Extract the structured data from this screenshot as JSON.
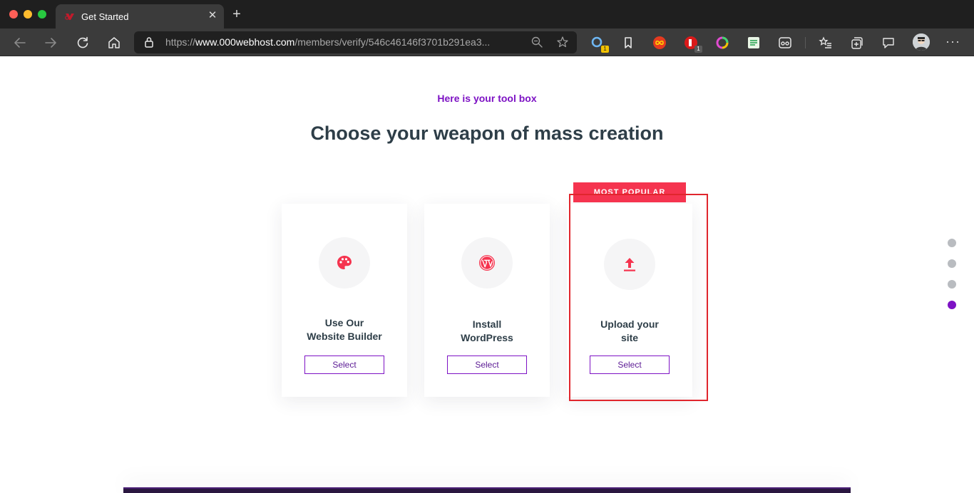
{
  "browser": {
    "tab_title": "Get Started",
    "url_scheme": "https://",
    "url_host": "www.000webhost.com",
    "url_path": "/members/verify/546c46146f3701b291ea3...",
    "extension_badges": [
      "1",
      "1"
    ]
  },
  "page": {
    "kicker": "Here is your tool box",
    "headline": "Choose your weapon of mass creation",
    "ribbon": "MOST POPULAR",
    "cards": [
      {
        "icon": "palette-icon",
        "label_line1": "Use Our",
        "label_line2": "Website Builder",
        "button": "Select"
      },
      {
        "icon": "wordpress-icon",
        "label_line1": "Install",
        "label_line2": "WordPress",
        "button": "Select"
      },
      {
        "icon": "upload-icon",
        "label_line1": "Upload your",
        "label_line2": "site",
        "button": "Select"
      }
    ],
    "pager": {
      "count": 4,
      "active_index": 3
    }
  },
  "colors": {
    "accent_purple": "#7d12c4",
    "accent_red": "#f5344f",
    "heading": "#2e3e48",
    "highlight": "#e0262d"
  }
}
